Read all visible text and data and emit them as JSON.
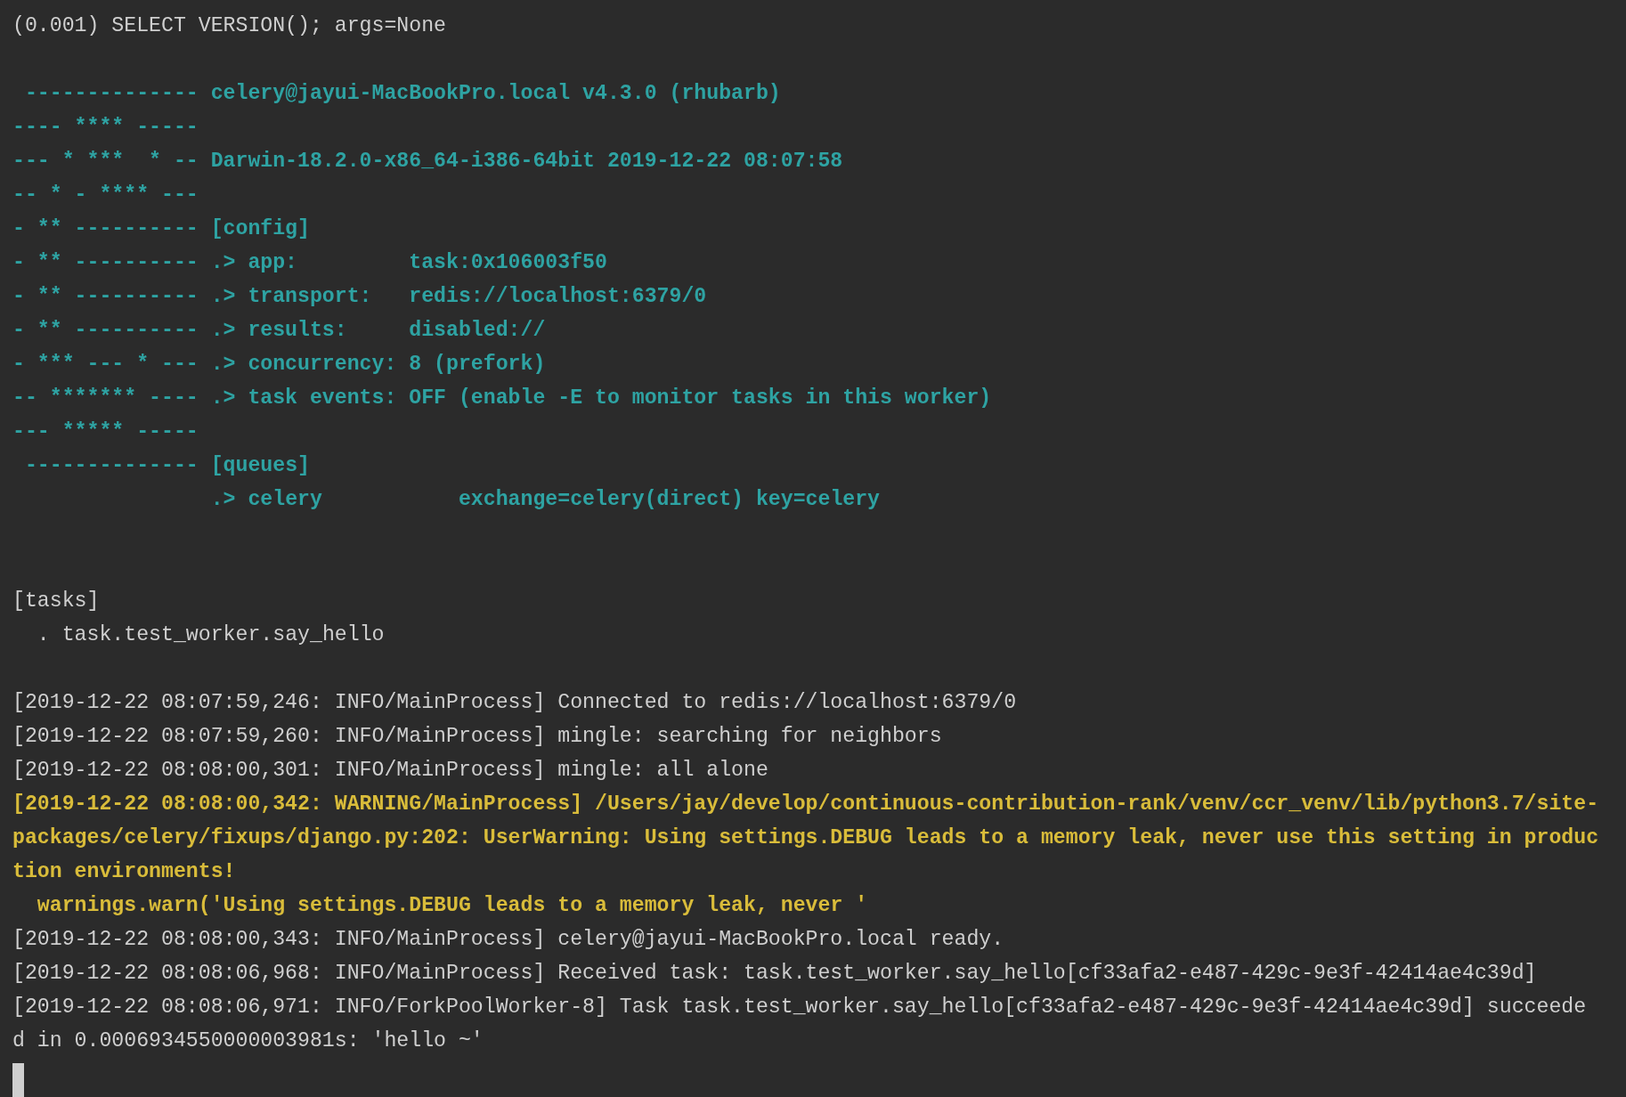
{
  "terminal": {
    "lines": [
      {
        "kind": "plain",
        "text": "(0.001) SELECT VERSION(); args=None"
      },
      {
        "kind": "blank"
      },
      {
        "kind": "banner",
        "text": " -------------- celery@jayui-MacBookPro.local v4.3.0 (rhubarb)"
      },
      {
        "kind": "banner",
        "text": "---- **** ----- "
      },
      {
        "kind": "banner",
        "text": "--- * ***  * -- Darwin-18.2.0-x86_64-i386-64bit 2019-12-22 08:07:58"
      },
      {
        "kind": "banner",
        "text": "-- * - **** --- "
      },
      {
        "kind": "banner",
        "text": "- ** ---------- [config]"
      },
      {
        "kind": "banner",
        "text": "- ** ---------- .> app:         task:0x106003f50"
      },
      {
        "kind": "banner",
        "text": "- ** ---------- .> transport:   redis://localhost:6379/0"
      },
      {
        "kind": "banner",
        "text": "- ** ---------- .> results:     disabled://"
      },
      {
        "kind": "banner",
        "text": "- *** --- * --- .> concurrency: 8 (prefork)"
      },
      {
        "kind": "banner",
        "text": "-- ******* ---- .> task events: OFF (enable -E to monitor tasks in this worker)"
      },
      {
        "kind": "banner",
        "text": "--- ***** ----- "
      },
      {
        "kind": "banner",
        "text": " -------------- [queues]"
      },
      {
        "kind": "banner",
        "text": "                .> celery           exchange=celery(direct) key=celery"
      },
      {
        "kind": "blank"
      },
      {
        "kind": "blank"
      },
      {
        "kind": "plain",
        "text": "[tasks]"
      },
      {
        "kind": "plain",
        "text": "  . task.test_worker.say_hello"
      },
      {
        "kind": "blank"
      },
      {
        "kind": "plain",
        "text": "[2019-12-22 08:07:59,246: INFO/MainProcess] Connected to redis://localhost:6379/0"
      },
      {
        "kind": "plain",
        "text": "[2019-12-22 08:07:59,260: INFO/MainProcess] mingle: searching for neighbors"
      },
      {
        "kind": "plain",
        "text": "[2019-12-22 08:08:00,301: INFO/MainProcess] mingle: all alone"
      },
      {
        "kind": "warning",
        "text": "[2019-12-22 08:08:00,342: WARNING/MainProcess] /Users/jay/develop/continuous-contribution-rank/venv/ccr_venv/lib/python3.7/site-packages/celery/fixups/django.py:202: UserWarning: Using settings.DEBUG leads to a memory leak, never use this setting in production environments!"
      },
      {
        "kind": "warning",
        "text": "  warnings.warn('Using settings.DEBUG leads to a memory leak, never '"
      },
      {
        "kind": "plain",
        "text": "[2019-12-22 08:08:00,343: INFO/MainProcess] celery@jayui-MacBookPro.local ready."
      },
      {
        "kind": "plain",
        "text": "[2019-12-22 08:08:06,968: INFO/MainProcess] Received task: task.test_worker.say_hello[cf33afa2-e487-429c-9e3f-42414ae4c39d]"
      },
      {
        "kind": "plain",
        "text": "[2019-12-22 08:08:06,971: INFO/ForkPoolWorker-8] Task task.test_worker.say_hello[cf33afa2-e487-429c-9e3f-42414ae4c39d] succeeded in 0.0006934550000003981s: 'hello ~'"
      },
      {
        "kind": "cursor"
      }
    ]
  }
}
